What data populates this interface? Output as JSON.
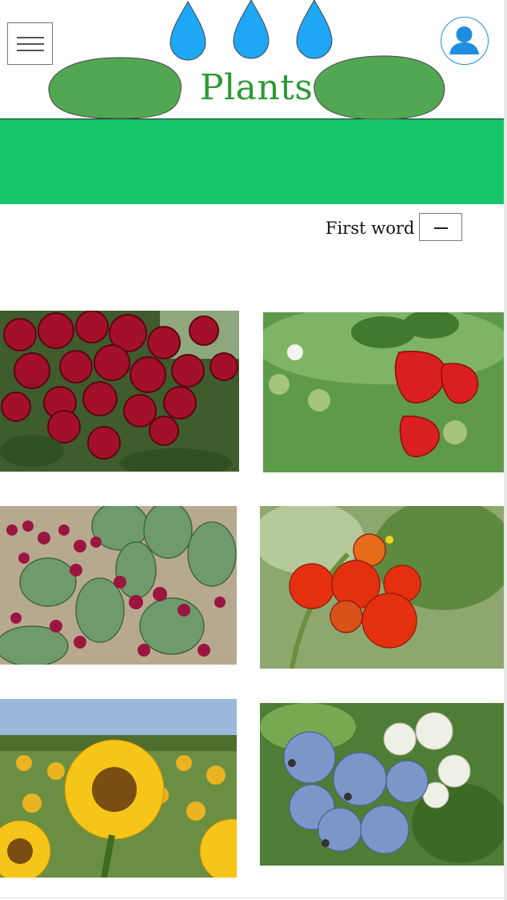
{
  "header": {
    "title": "Plants",
    "menu_icon": "hamburger-menu-icon",
    "profile_icon": "user-avatar-icon"
  },
  "colors": {
    "title": "#2c9a35",
    "banner": "#16c46a",
    "drops": "#1ea7f5",
    "stones": "#52a852",
    "avatar": "#1e8fe0"
  },
  "filter": {
    "label": "First word",
    "toggle_icon": "minus-icon"
  },
  "gallery": {
    "items": [
      {
        "name": "red-roses-photo"
      },
      {
        "name": "strawberries-photo"
      },
      {
        "name": "prickly-pear-cactus-photo"
      },
      {
        "name": "tomatoes-photo"
      },
      {
        "name": "sunflowers-photo"
      },
      {
        "name": "blueberries-photo"
      }
    ]
  }
}
